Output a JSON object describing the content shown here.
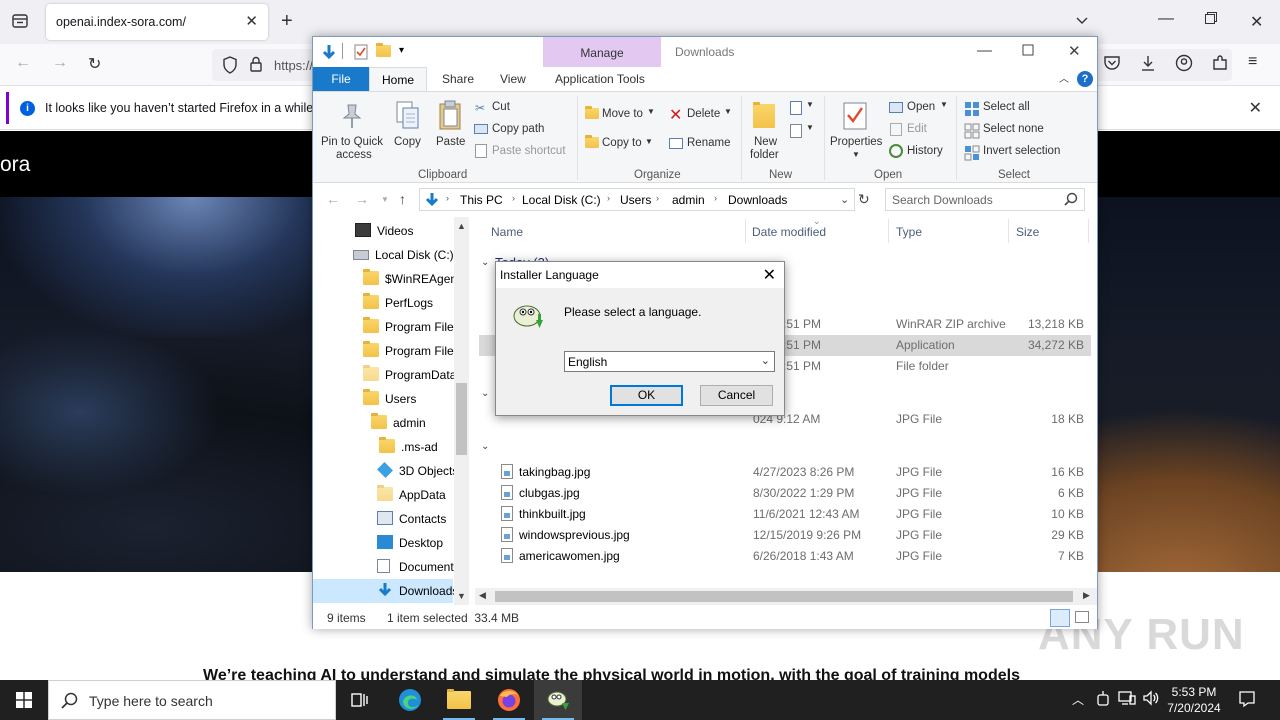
{
  "browser": {
    "tab_title": "openai.index-sora.com/",
    "url": "https://",
    "notice": "It looks like you haven’t started Firefox in a while. D"
  },
  "website": {
    "brand": "ora",
    "tagline": "We’re teaching AI to understand and simulate the physical world in motion, with the goal of training models"
  },
  "explorer": {
    "context_tab": "Manage",
    "title": "Downloads",
    "tabs": {
      "file": "File",
      "home": "Home",
      "share": "Share",
      "view": "View",
      "app_tools": "Application Tools"
    },
    "ribbon": {
      "clipboard": {
        "pin": "Pin to Quick",
        "pin2": "access",
        "copy": "Copy",
        "paste": "Paste",
        "cut": "Cut",
        "copy_path": "Copy path",
        "paste_shortcut": "Paste shortcut",
        "label": "Clipboard"
      },
      "organize": {
        "move_to": "Move to",
        "copy_to": "Copy to",
        "delete": "Delete",
        "rename": "Rename",
        "label": "Organize"
      },
      "new": {
        "new_folder": "New",
        "new_folder2": "folder",
        "label": "New"
      },
      "open": {
        "properties": "Properties",
        "open": "Open",
        "edit": "Edit",
        "history": "History",
        "label": "Open"
      },
      "select": {
        "select_all": "Select all",
        "select_none": "Select none",
        "invert": "Invert selection",
        "label": "Select"
      }
    },
    "breadcrumb": [
      "This PC",
      "Local Disk (C:)",
      "Users",
      "admin",
      "Downloads"
    ],
    "search_placeholder": "Search Downloads",
    "nav": [
      "Videos",
      "Local Disk (C:)",
      "$WinREAgent",
      "PerfLogs",
      "Program Files",
      "Program Files",
      "ProgramData",
      "Users",
      "admin",
      ".ms-ad",
      "3D Objects",
      "AppData",
      "Contacts",
      "Desktop",
      "Documents",
      "Downloads"
    ],
    "columns": {
      "name": "Name",
      "date": "Date modified",
      "type": "Type",
      "size": "Size"
    },
    "group_today": "Today (3)",
    "rows_top": [
      {
        "date": "024 5:51 PM",
        "type": "WinRAR ZIP archive",
        "size": "13,218 KB"
      },
      {
        "date": "024 5:51 PM",
        "type": "Application",
        "size": "34,272 KB"
      },
      {
        "date": "024 5:51 PM",
        "type": "File folder",
        "size": ""
      },
      {
        "date": "024 9:12 AM",
        "type": "JPG File",
        "size": "18 KB"
      }
    ],
    "files": [
      {
        "name": "takingbag.jpg",
        "date": "4/27/2023 8:26 PM",
        "type": "JPG File",
        "size": "16 KB"
      },
      {
        "name": "clubgas.jpg",
        "date": "8/30/2022 1:29 PM",
        "type": "JPG File",
        "size": "6 KB"
      },
      {
        "name": "thinkbuilt.jpg",
        "date": "11/6/2021 12:43 AM",
        "type": "JPG File",
        "size": "10 KB"
      },
      {
        "name": "windowsprevious.jpg",
        "date": "12/15/2019 9:26 PM",
        "type": "JPG File",
        "size": "29 KB"
      },
      {
        "name": "americawomen.jpg",
        "date": "6/26/2018 1:43 AM",
        "type": "JPG File",
        "size": "7 KB"
      }
    ],
    "status": {
      "items": "9 items",
      "selected": "1 item selected  33.4 MB"
    }
  },
  "dialog": {
    "title": "Installer Language",
    "message": "Please select a language.",
    "language": "English",
    "ok": "OK",
    "cancel": "Cancel"
  },
  "taskbar": {
    "search_placeholder": "Type here to search",
    "time": "5:53 PM",
    "date": "7/20/2024"
  },
  "watermark": "ANY RUN",
  "colors": {
    "file_tab": "#1979ca",
    "manage_tab": "#e3c8f2",
    "selection": "#cce8ff",
    "taskbar": "#202020"
  }
}
